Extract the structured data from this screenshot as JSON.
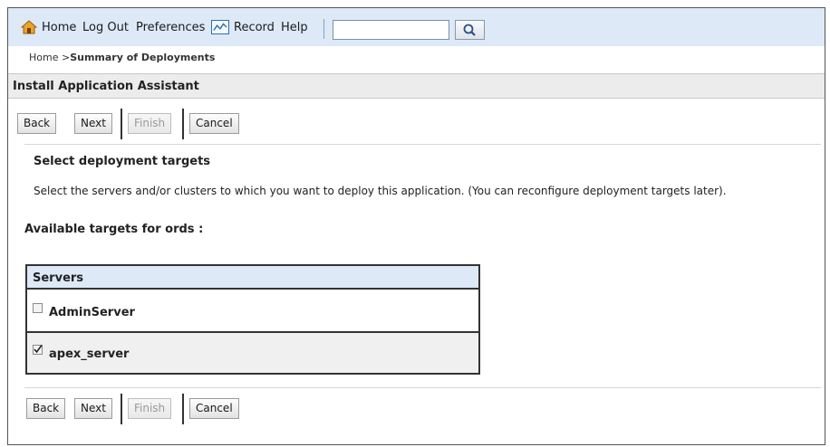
{
  "topbar": {
    "home": "Home",
    "logout": "Log Out",
    "preferences": "Preferences",
    "record": "Record",
    "help": "Help",
    "search_value": "",
    "icons": [
      "home-icon",
      "record-icon",
      "search-icon"
    ]
  },
  "breadcrumb": {
    "home": "Home",
    "separator": ">",
    "current": "Summary of Deployments"
  },
  "panel": {
    "title": "Install Application Assistant"
  },
  "buttons": {
    "back": "Back",
    "next": "Next",
    "finish": "Finish",
    "cancel": "Cancel"
  },
  "section": {
    "title": "Select deployment targets",
    "description": "Select the servers and/or clusters to which you want to deploy this application. (You can reconfigure deployment targets later)."
  },
  "targets": {
    "label": "Available targets for ords :",
    "column_header": "Servers",
    "servers": [
      {
        "name": "AdminServer",
        "checked": false
      },
      {
        "name": "apex_server",
        "checked": true
      }
    ]
  },
  "colors": {
    "topbar": "#dde9f7",
    "panel_header": "#ececec",
    "table_header": "#dde9f7"
  }
}
